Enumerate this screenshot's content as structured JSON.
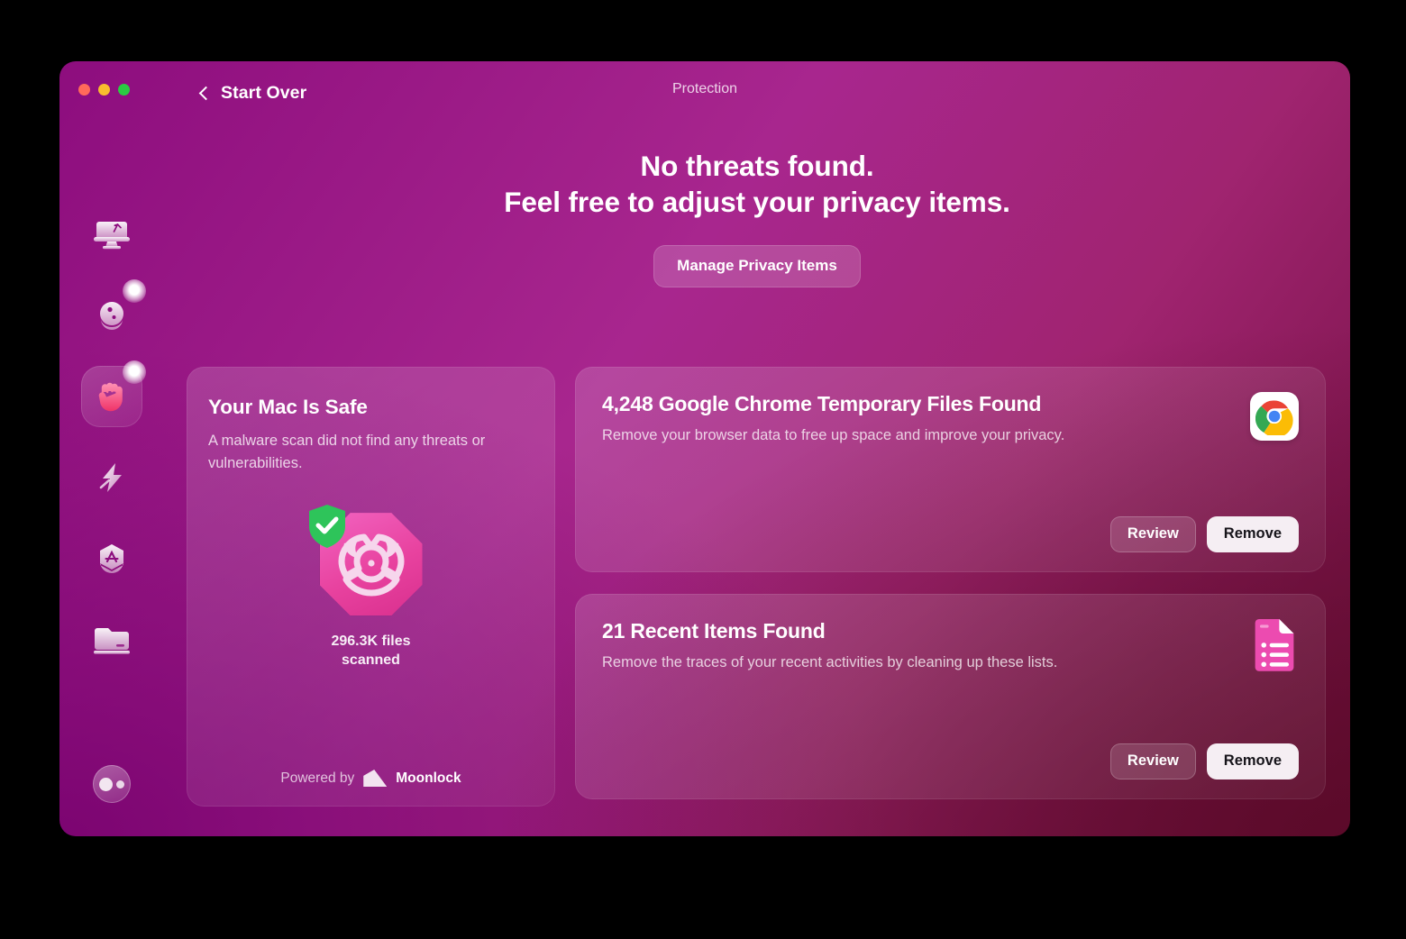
{
  "window": {
    "title": "Protection",
    "back_label": "Start Over",
    "traffic_lights": [
      "close",
      "minimize",
      "zoom"
    ]
  },
  "hero": {
    "line1": "No threats found.",
    "line2": "Feel free to adjust your privacy items.",
    "cta_label": "Manage Privacy Items"
  },
  "sidebar": {
    "items": [
      {
        "name": "smart-scan",
        "icon": "monitor-icon",
        "active": false,
        "badge": false
      },
      {
        "name": "cleanup",
        "icon": "droplet-icon",
        "active": false,
        "badge": true
      },
      {
        "name": "protection",
        "icon": "hand-icon",
        "active": true,
        "badge": true
      },
      {
        "name": "performance",
        "icon": "lightning-icon",
        "active": false,
        "badge": false
      },
      {
        "name": "applications",
        "icon": "hexagon-tools-icon",
        "active": false,
        "badge": false
      },
      {
        "name": "my-clutter",
        "icon": "folder-icon",
        "active": false,
        "badge": false
      }
    ],
    "account": {
      "name": "account-avatar"
    }
  },
  "safe_card": {
    "title": "Your Mac Is Safe",
    "description": "A malware scan did not find any threats or vulnerabilities.",
    "scan_count_line1": "296.3K files",
    "scan_count_line2": "scanned",
    "icon": "biohazard-shield-icon",
    "footer_prefix": "Powered by",
    "footer_brand": "Moonlock"
  },
  "items": [
    {
      "title": "4,248 Google Chrome Temporary Files Found",
      "description": "Remove your browser data to free up space and improve your privacy.",
      "icon": "google-chrome-icon",
      "review_label": "Review",
      "remove_label": "Remove"
    },
    {
      "title": "21 Recent Items Found",
      "description": "Remove the traces of your recent activities by cleaning up these lists.",
      "icon": "recent-items-document-icon",
      "review_label": "Review",
      "remove_label": "Remove"
    }
  ],
  "colors": {
    "accent_magenta": "#A8268E",
    "deep_purple": "#7A0370",
    "dark_maroon": "#5A0A28",
    "safe_green": "#2ec45a",
    "pink_icon": "#E8429F",
    "remove_button": "#F5EEF3"
  }
}
